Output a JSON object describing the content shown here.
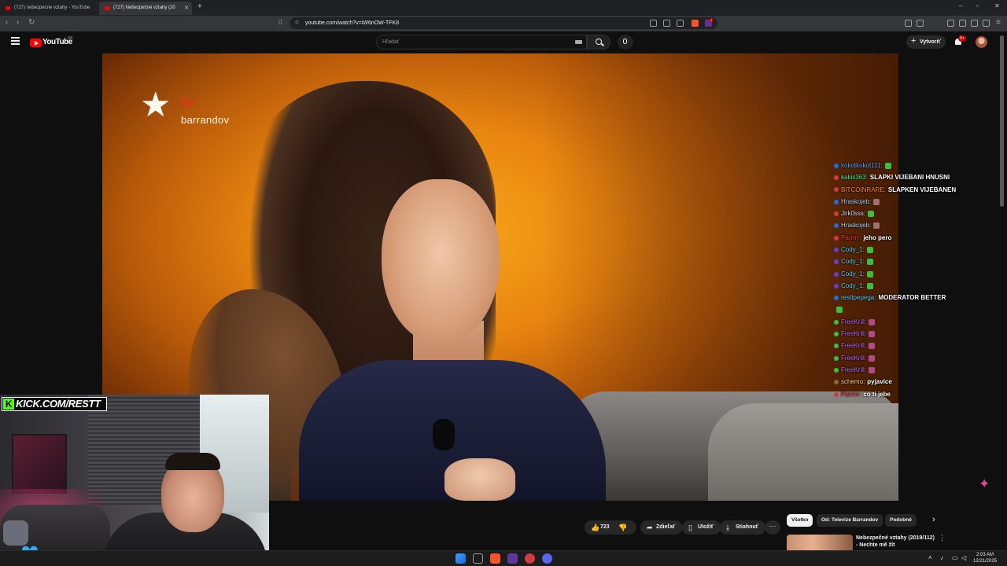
{
  "browser": {
    "tabs": [
      {
        "title": "(727) nebezpecne vztahy - YouTube",
        "active": false
      },
      {
        "title": "(727) Nebezpečné vztahy (20",
        "active": true
      }
    ],
    "new_tab": "+",
    "window_controls": {
      "minimize": "–",
      "maximize": "▫",
      "close": "✕"
    },
    "nav": {
      "back": "‹",
      "forward": "›",
      "reload": "↻"
    },
    "url": "youtube.com/watch?v=iW6nOW-TFK8",
    "extension_badge": "1"
  },
  "youtube": {
    "logo_text": "YouTube",
    "country_code": "SK",
    "search_placeholder": "Hľadať",
    "create_label": "Vytvoriť",
    "notification_badge": "9+",
    "video_logo": {
      "tv": "tv",
      "brand": "barrandov"
    },
    "actions": {
      "like_count": "723",
      "share_label": "Zdieľať",
      "save_label": "Uložiť",
      "download_label": "Stiahnuť",
      "more_label": "···"
    },
    "filter_chips": [
      {
        "label": "Všetko",
        "active": true
      },
      {
        "label": "Od: Televize Barrandov",
        "active": false
      },
      {
        "label": "Podobné",
        "active": false
      }
    ],
    "recommendation": {
      "title": "Nebezpečné vztahy (2019/112)",
      "subtitle": "- Nechte mě žít"
    }
  },
  "overlay": {
    "kick_text": "KICK.COM/RESTT",
    "kick_k": "K",
    "chat": [
      {
        "user": "kokotkokot111:",
        "text": "",
        "color": "#4fa3ff",
        "badge": "#1e6fd9",
        "emote": "#3cbf3c"
      },
      {
        "user": "kakis363:",
        "text": "SLAPKI VIJEBANI HNUSNI",
        "color": "#3cf0a0",
        "badge": "#d13b3b",
        "emote": ""
      },
      {
        "user": "BITCOINRARE:",
        "text": "SLAPKEN VIJEBANEN",
        "color": "#ff8c1a",
        "badge": "#d13b3b",
        "emote": ""
      },
      {
        "user": "Hraskojeb:",
        "text": "",
        "color": "#9fd3ff",
        "badge": "#1e6fd9",
        "emote": "#a07070"
      },
      {
        "user": "Jirk0sss:",
        "text": "",
        "color": "#d8d8ff",
        "badge": "#d13b3b",
        "emote": "#3cbf3c"
      },
      {
        "user": "Hraskojeb:",
        "text": "",
        "color": "#9fd3ff",
        "badge": "#1e6fd9",
        "emote": "#a07070"
      },
      {
        "user": "Parrrrr:",
        "text": "jeho pero",
        "color": "#ff3333",
        "badge": "#d13b3b",
        "emote": ""
      },
      {
        "user": "Cody_1:",
        "text": "",
        "color": "#4fd0ff",
        "badge": "#6b3bd1",
        "emote": "#3cbf3c"
      },
      {
        "user": "Cody_1:",
        "text": "",
        "color": "#4fd0ff",
        "badge": "#6b3bd1",
        "emote": "#3cbf3c"
      },
      {
        "user": "Cody_1:",
        "text": "",
        "color": "#4fd0ff",
        "badge": "#6b3bd1",
        "emote": "#3cbf3c"
      },
      {
        "user": "Cody_1:",
        "text": "",
        "color": "#4fd0ff",
        "badge": "#6b3bd1",
        "emote": "#3cbf3c"
      },
      {
        "user": "resttpepega:",
        "text": "MODERATOR BETTER",
        "color": "#5ad0ff",
        "badge": "#1e6fd9",
        "emote": ""
      },
      {
        "user": "",
        "text": "",
        "color": "#ffffff",
        "badge": "",
        "emote": "#3cbf3c"
      },
      {
        "user": "FreeKrill:",
        "text": "",
        "color": "#b066ff",
        "badge": "#3cbf3c",
        "emote": "#b04a8a"
      },
      {
        "user": "FreeKrill:",
        "text": "",
        "color": "#b066ff",
        "badge": "#3cbf3c",
        "emote": "#b04a8a"
      },
      {
        "user": "FreeKrill:",
        "text": "",
        "color": "#b066ff",
        "badge": "#3cbf3c",
        "emote": "#b04a8a"
      },
      {
        "user": "FreeKrill:",
        "text": "",
        "color": "#b066ff",
        "badge": "#3cbf3c",
        "emote": "#b04a8a"
      },
      {
        "user": "FreeKrill:",
        "text": "",
        "color": "#b066ff",
        "badge": "#3cbf3c",
        "emote": "#b04a8a"
      },
      {
        "user": "schemo:",
        "text": "pyjavice",
        "color": "#ffd28a",
        "badge": "#8a6a3a",
        "emote": ""
      },
      {
        "user": "Parrrrr:",
        "text": "co ti jebe",
        "color": "#ff3333",
        "badge": "#d13b3b",
        "emote": ""
      }
    ]
  },
  "taskbar": {
    "time": "2:03 AM",
    "date": "12/21/2025"
  },
  "colors": {
    "youtube_red": "#ff0000",
    "kick_green": "#53fc18",
    "background": "#0f0f0f"
  }
}
